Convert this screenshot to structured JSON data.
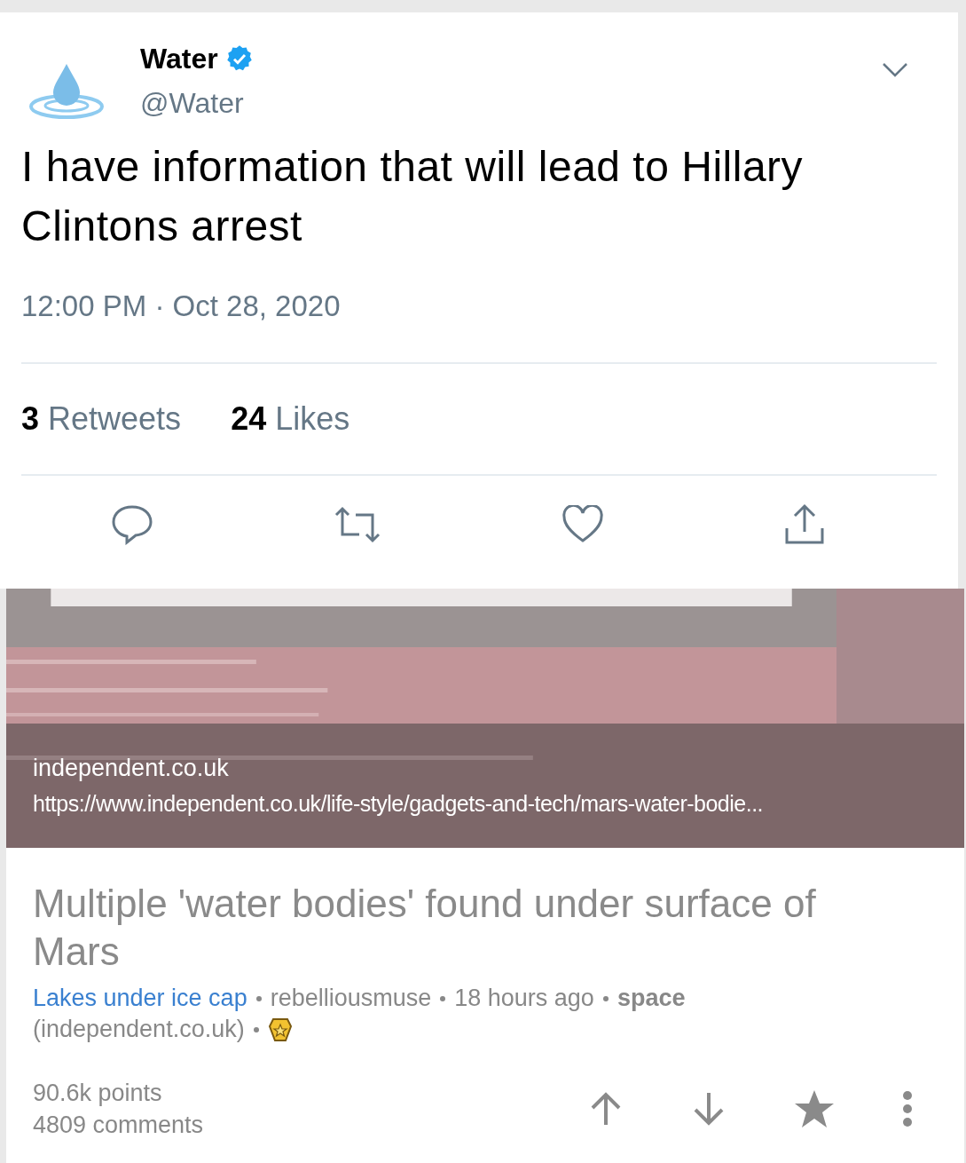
{
  "tweet": {
    "author": {
      "name": "Water",
      "handle": "@Water",
      "verified": true
    },
    "text": "I have information that will lead to Hillary Clintons arrest",
    "timestamp": "12:00 PM · Oct 28, 2020",
    "stats": [
      {
        "count": "3",
        "label": "Retweets"
      },
      {
        "count": "24",
        "label": "Likes"
      }
    ]
  },
  "post": {
    "link_preview": {
      "domain": "independent.co.uk",
      "url": "https://www.independent.co.uk/life-style/gadgets-and-tech/mars-water-bodie..."
    },
    "title": "Multiple 'water bodies' found under surface of Mars",
    "flair": "Lakes under ice cap",
    "author": "rebelliousmuse",
    "time": "18 hours ago",
    "subreddit": "space",
    "source": "(independent.co.uk)",
    "points": "90.6k points",
    "comments": "4809 comments"
  }
}
